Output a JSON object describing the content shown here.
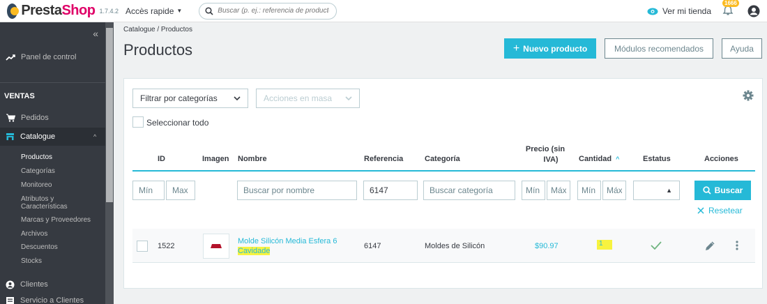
{
  "header": {
    "logo_text_a": "Presta",
    "logo_text_b": "Shop",
    "version": "1.7.4.2",
    "quick_access": "Accès rapide",
    "search_placeholder": "Buscar (p. ej.: referencia de producto, no",
    "view_shop": "Ver mi tienda",
    "notifications_count": "1666"
  },
  "sidebar": {
    "dashboard": "Panel de control",
    "section_sales": "VENTAS",
    "orders": "Pedidos",
    "catalogue": "Catalogue",
    "sub_items": [
      "Productos",
      "Categorías",
      "Monitoreo",
      "Atributos y",
      "Características",
      "Marcas y Proveedores",
      "Archivos",
      "Descuentos",
      "Stocks"
    ],
    "customers": "Clientes",
    "customer_service": "Servicio a Clientes"
  },
  "breadcrumb": "Catalogue  /  Productos",
  "page_title": "Productos",
  "buttons": {
    "new_product": "Nuevo producto",
    "recommended_modules": "Módulos recomendados",
    "help": "Ayuda"
  },
  "toolbar": {
    "filter_categories": "Filtrar por categorías",
    "bulk_actions": "Acciones en masa",
    "select_all": "Seleccionar todo"
  },
  "table": {
    "headers": {
      "id": "ID",
      "image": "Imagen",
      "name": "Nombre",
      "reference": "Referencia",
      "category": "Categoría",
      "price_line1": "Precio (sin",
      "price_line2": "IVA)",
      "quantity": "Cantidad",
      "status": "Estatus",
      "actions": "Acciones"
    },
    "filters": {
      "id_min": "Mín",
      "id_max": "Max",
      "name_placeholder": "Buscar por nombre",
      "reference_value": "6147",
      "category_placeholder": "Buscar categoría",
      "price_min": "Mín",
      "price_max": "Máx",
      "qty_min": "Mín",
      "qty_max": "Máx",
      "search_button": "Buscar",
      "reset": "Resetear"
    },
    "rows": [
      {
        "id": "1522",
        "name_line1": "Molde Silicón Media Esfera 6",
        "name_line2": "Cavidade",
        "reference": "6147",
        "category": "Moldes de Silicón",
        "price": "$90.97",
        "quantity": "1"
      }
    ]
  },
  "colors": {
    "primary": "#25b9d7",
    "sidebar": "#363a41",
    "highlight": "#f7f33f",
    "success": "#70b580"
  }
}
